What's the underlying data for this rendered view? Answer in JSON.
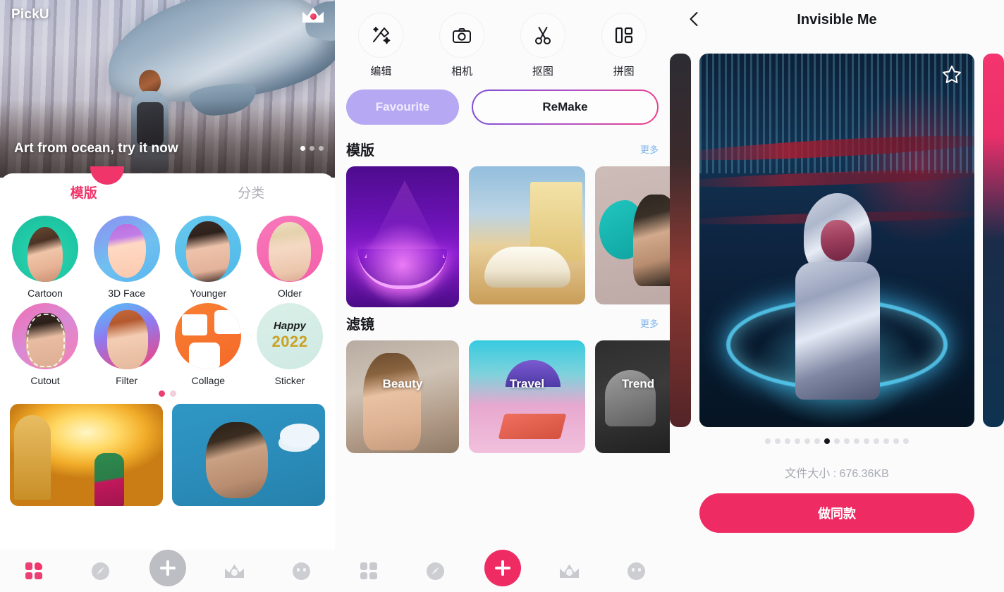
{
  "left": {
    "brand": "PickU",
    "crown_icon": "crown-icon",
    "hero": {
      "caption": "Art from ocean, try it now",
      "dots_total": 3,
      "dots_active": 0
    },
    "tabs": [
      {
        "label": "模版",
        "active": true
      },
      {
        "label": "分类",
        "active": false
      }
    ],
    "features": [
      {
        "label": "Cartoon",
        "style": "b-cartoon"
      },
      {
        "label": "3D Face",
        "style": "b-3d"
      },
      {
        "label": "Younger",
        "style": "b-young"
      },
      {
        "label": "Older",
        "style": "b-older"
      },
      {
        "label": "Cutout",
        "style": "b-cutout"
      },
      {
        "label": "Filter",
        "style": "b-filter"
      },
      {
        "label": "Collage",
        "style": "b-collage"
      },
      {
        "label": "Sticker",
        "style": "b-sticker"
      }
    ],
    "feature_pager": {
      "total": 2,
      "active": 0
    },
    "feed": [
      {
        "name": "temple-stairs-card"
      },
      {
        "name": "comic-portrait-card"
      }
    ],
    "bottom_nav": [
      {
        "icon": "grid-icon",
        "active": true
      },
      {
        "icon": "compass-icon",
        "active": false
      },
      {
        "icon": "plus-icon",
        "active": false,
        "state": "disabled"
      },
      {
        "icon": "crown-icon",
        "active": false
      },
      {
        "icon": "face-icon",
        "active": false
      }
    ]
  },
  "mid": {
    "tools": [
      {
        "label": "编辑",
        "icon": "magic-wand-icon"
      },
      {
        "label": "相机",
        "icon": "camera-icon"
      },
      {
        "label": "抠图",
        "icon": "scissors-icon"
      },
      {
        "label": "拼图",
        "icon": "collage-layout-icon"
      }
    ],
    "favourite_label": "Favourite",
    "remake_label": "ReMake",
    "sections": [
      {
        "title": "模版",
        "more": "更多",
        "cards": [
          {
            "name": "neon-triangle-template",
            "style": "tpl-1"
          },
          {
            "name": "vintage-car-template",
            "style": "tpl-2"
          },
          {
            "name": "paint-splash-template",
            "style": "tpl-3"
          }
        ]
      },
      {
        "title": "滤镜",
        "more": "更多",
        "cards": [
          {
            "label": "Beauty",
            "style": "flt-1"
          },
          {
            "label": "Travel",
            "style": "flt-2"
          },
          {
            "label": "Trend",
            "style": "flt-3"
          }
        ]
      }
    ],
    "bottom_nav": [
      {
        "icon": "grid-icon",
        "active": false
      },
      {
        "icon": "compass-icon",
        "active": false
      },
      {
        "icon": "plus-icon",
        "active": true
      },
      {
        "icon": "crown-icon",
        "active": false
      },
      {
        "icon": "face-icon",
        "active": false
      }
    ]
  },
  "right": {
    "back_icon": "chevron-left-icon",
    "title": "Invisible Me",
    "favourite_icon": "star-outline-icon",
    "preview_name": "cyberpunk-hooded-figure-preview",
    "pager": {
      "total": 15,
      "active": 6
    },
    "file_size": "文件大小 : 676.36KB",
    "cta_label": "做同款"
  },
  "colors": {
    "accent_pink": "#ef2b63",
    "tab_pink": "#f0356b",
    "favourite_purple": "#b6a8f2",
    "more_link_blue": "#7fb4ea",
    "remake_gradient_start": "#7e4fd6",
    "remake_gradient_end": "#ee3f85"
  }
}
